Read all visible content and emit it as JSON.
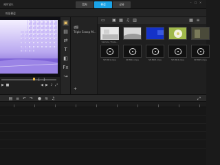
{
  "app": {
    "title": "제이일드",
    "menu_label": "파일편집",
    "modes": [
      {
        "label": "캡처",
        "active": false
      },
      {
        "label": "편집",
        "active": true
      },
      {
        "label": "공유",
        "active": false
      }
    ]
  },
  "library": {
    "folder_items": [
      "샘플",
      "Triple Scoop M..."
    ],
    "thumbnails": [
      {
        "label": "Sample_Triple...",
        "kind": "photo"
      },
      {
        "label": "",
        "kind": "photo"
      },
      {
        "label": "",
        "kind": "photo"
      },
      {
        "label": "",
        "kind": "photo"
      },
      {
        "label": "",
        "kind": "photo"
      },
      {
        "label": "SP-M01.mpa",
        "kind": "music"
      },
      {
        "label": "SP-M02.mpa",
        "kind": "music"
      },
      {
        "label": "SP-M03.mpa",
        "kind": "music"
      },
      {
        "label": "SP-M04.mpa",
        "kind": "music"
      },
      {
        "label": "SP-M05.mpa",
        "kind": "music"
      }
    ]
  },
  "icons": {
    "accent": "#1aa3e8",
    "highlight": "#e8b64a"
  }
}
